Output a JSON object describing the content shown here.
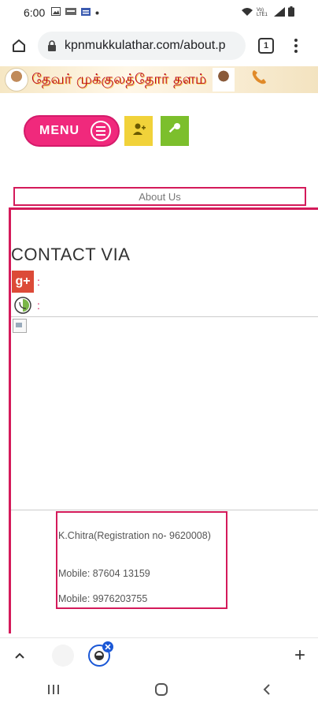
{
  "status_bar": {
    "time": "6:00",
    "icons": [
      "gallery-icon",
      "messages-icon",
      "news-icon",
      "dot-icon"
    ],
    "right_icons": [
      "wifi-icon",
      "volte-icon",
      "signal-icon",
      "battery-icon"
    ],
    "volte_label": "Vo) LTE1"
  },
  "browser": {
    "url": "kpnmukkulathar.com/about.p",
    "tab_count": "1"
  },
  "banner": {
    "title": "தேவர் முக்குலத்தோர் தளம்",
    "icons": [
      "person-icon",
      "phone-icon"
    ]
  },
  "nav": {
    "menu_label": "MENU",
    "icons": [
      "hamburger-icon",
      "add-user-icon",
      "key-icon"
    ]
  },
  "page": {
    "section_title": "About Us",
    "contact_heading": "CONTACT VIA",
    "gplus_label": "g+",
    "colon": ":"
  },
  "contact": {
    "name": "K.Chitra(Registration no- 9620008)",
    "mobile1": "Mobile: 87604 13159",
    "mobile2": "Mobile: 9976203755"
  },
  "bottom_bar": {
    "plus": "+",
    "icons": [
      "chevron-up-icon",
      "crescent-tab-icon",
      "close-badge-icon",
      "new-tab-icon"
    ]
  },
  "system_nav": {
    "icons": [
      "recents-icon",
      "home-icon",
      "back-icon"
    ]
  },
  "colors": {
    "accent": "#d41a5a",
    "menu_pink": "#f0297c",
    "yellow_button": "#f1d23a",
    "green_button": "#7cbf2c",
    "gplus_red": "#dc4a38"
  }
}
